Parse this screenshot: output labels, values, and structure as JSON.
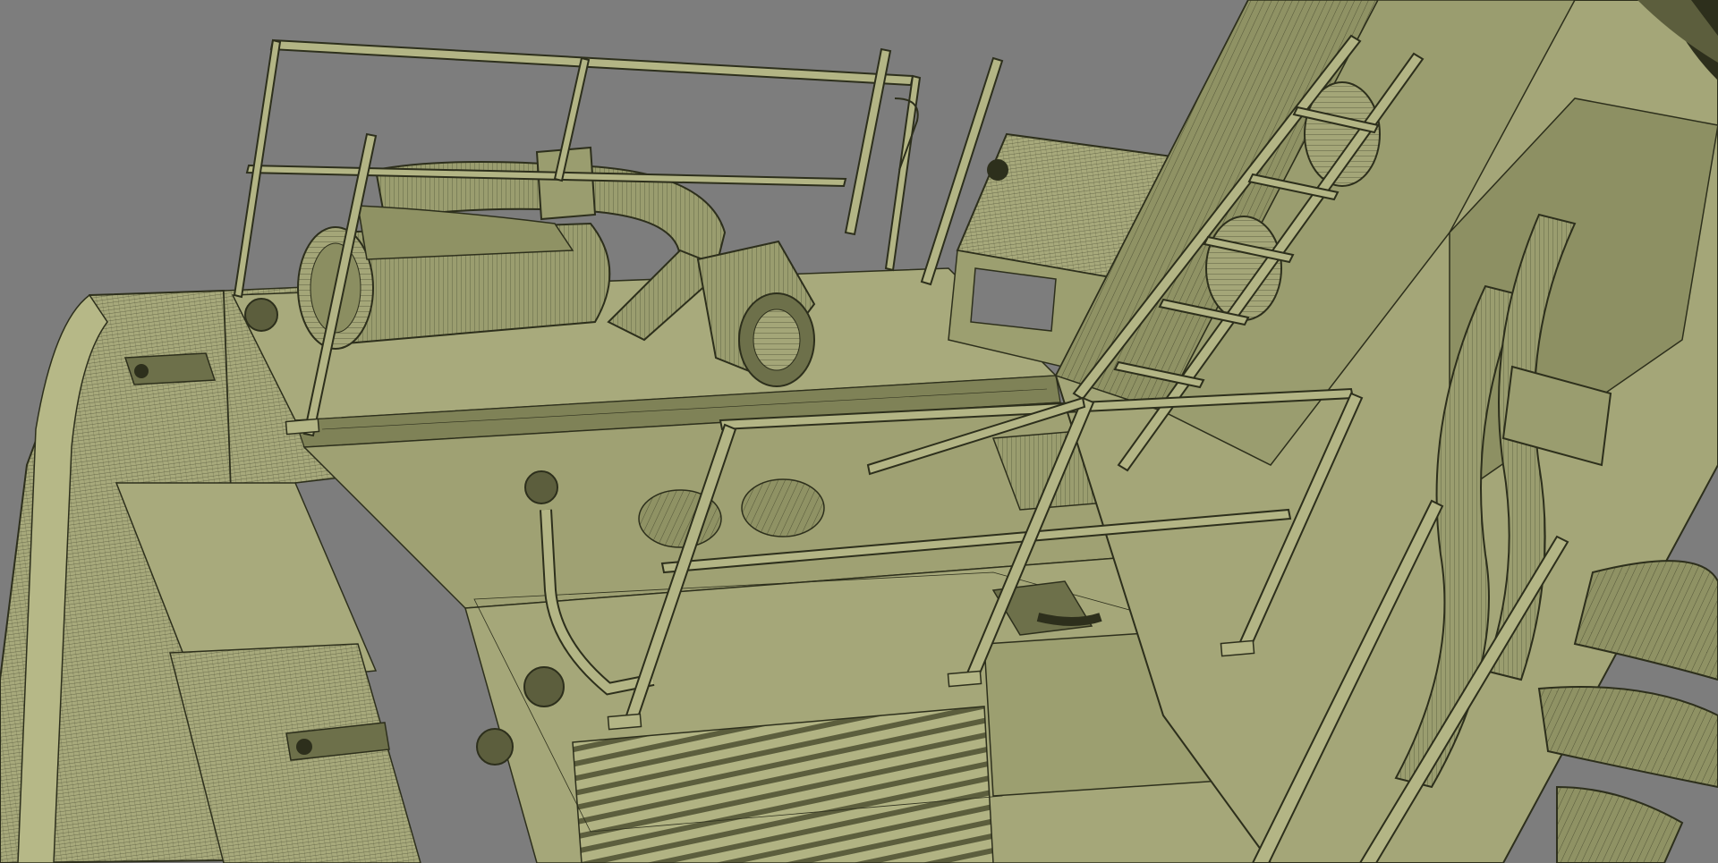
{
  "scene": {
    "description_tag": "wireframe-3d-render",
    "colors": {
      "background": "#7d7d7d",
      "surface": "#a4a678",
      "surface_light": "#b3b585",
      "surface_dark": "#7f8257",
      "shadow": "#5c5e3d",
      "wire": "#2d2f1c"
    }
  }
}
